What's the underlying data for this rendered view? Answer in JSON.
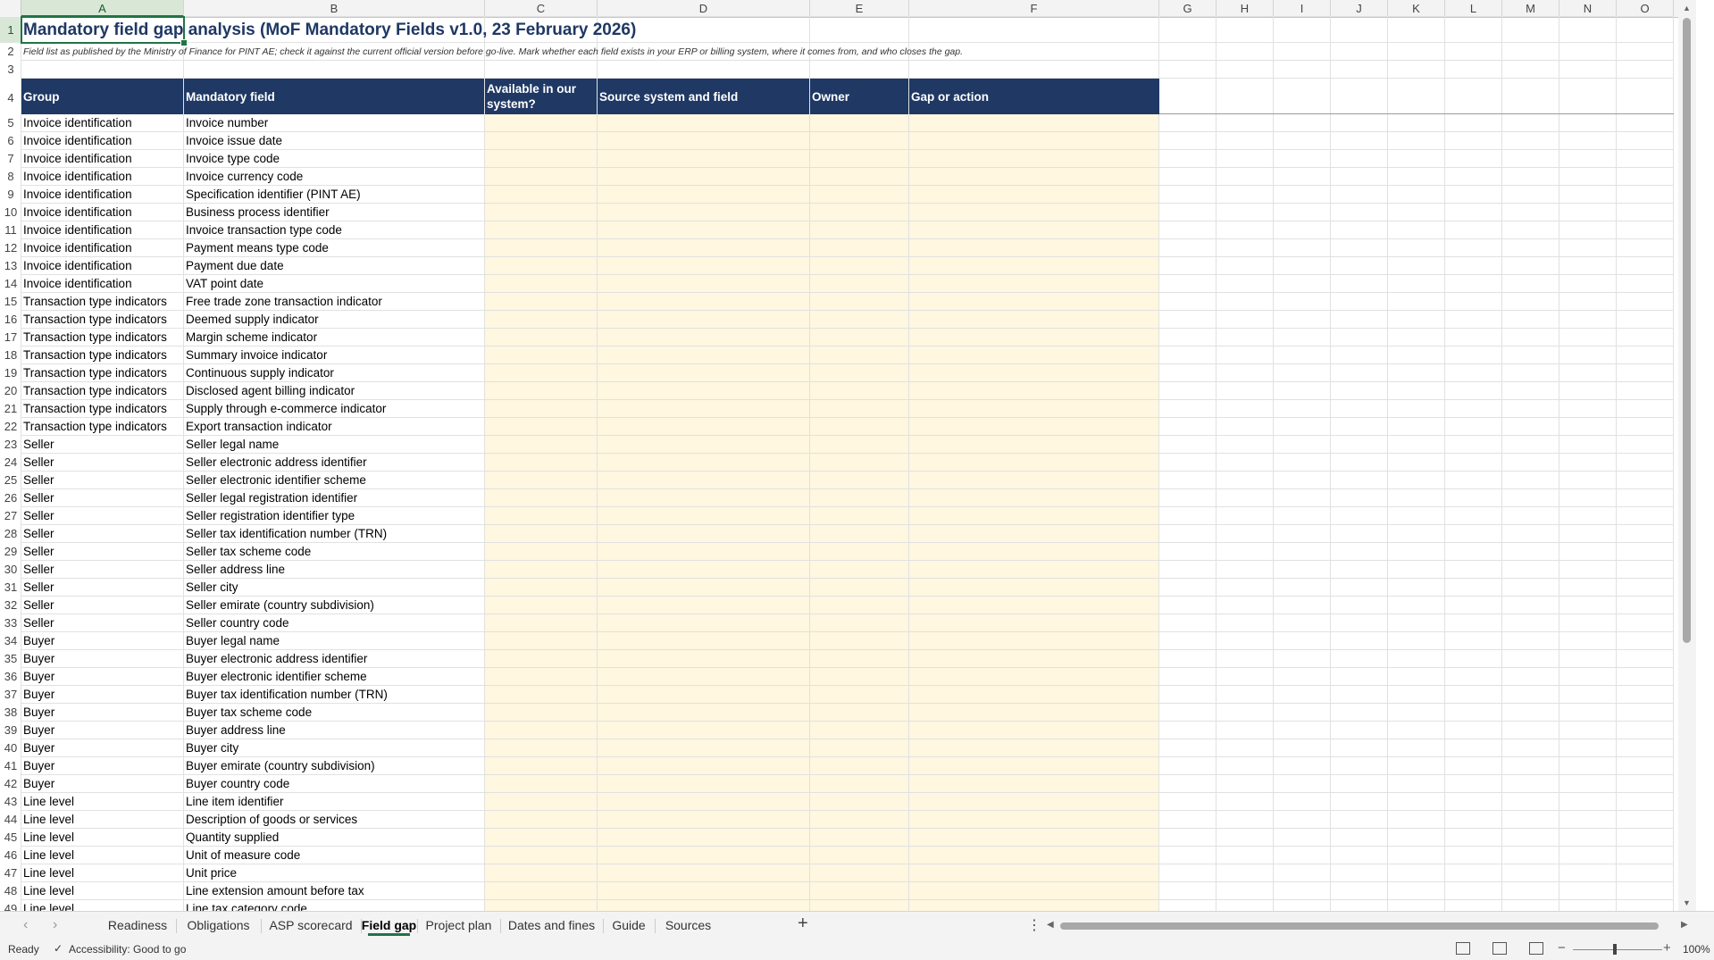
{
  "sheet": {
    "columns": [
      "A",
      "B",
      "C",
      "D",
      "E",
      "F",
      "G",
      "H",
      "I",
      "J",
      "K",
      "L",
      "M",
      "N",
      "O"
    ],
    "selected_cell": "A1",
    "title": "Mandatory field gap analysis (MoF Mandatory Fields v1.0, 23 February 2026)",
    "subtitle": "Field list as published by the Ministry of Finance for PINT AE; check it against the current official version before go-live. Mark whether each field exists in your ERP or billing system, where it comes from, and who closes the gap.",
    "headers": [
      "Group",
      "Mandatory field",
      "Available in our system?",
      "Source system and field",
      "Owner",
      "Gap or action"
    ],
    "rows": [
      [
        "Invoice identification",
        "Invoice number"
      ],
      [
        "Invoice identification",
        "Invoice issue date"
      ],
      [
        "Invoice identification",
        "Invoice type code"
      ],
      [
        "Invoice identification",
        "Invoice currency code"
      ],
      [
        "Invoice identification",
        "Specification identifier (PINT AE)"
      ],
      [
        "Invoice identification",
        "Business process identifier"
      ],
      [
        "Invoice identification",
        "Invoice transaction type code"
      ],
      [
        "Invoice identification",
        "Payment means type code"
      ],
      [
        "Invoice identification",
        "Payment due date"
      ],
      [
        "Invoice identification",
        "VAT point date"
      ],
      [
        "Transaction type indicators",
        "Free trade zone transaction indicator"
      ],
      [
        "Transaction type indicators",
        "Deemed supply indicator"
      ],
      [
        "Transaction type indicators",
        "Margin scheme indicator"
      ],
      [
        "Transaction type indicators",
        "Summary invoice indicator"
      ],
      [
        "Transaction type indicators",
        "Continuous supply indicator"
      ],
      [
        "Transaction type indicators",
        "Disclosed agent billing indicator"
      ],
      [
        "Transaction type indicators",
        "Supply through e-commerce indicator"
      ],
      [
        "Transaction type indicators",
        "Export transaction indicator"
      ],
      [
        "Seller",
        "Seller legal name"
      ],
      [
        "Seller",
        "Seller electronic address identifier"
      ],
      [
        "Seller",
        "Seller electronic identifier scheme"
      ],
      [
        "Seller",
        "Seller legal registration identifier"
      ],
      [
        "Seller",
        "Seller registration identifier type"
      ],
      [
        "Seller",
        "Seller tax identification number (TRN)"
      ],
      [
        "Seller",
        "Seller tax scheme code"
      ],
      [
        "Seller",
        "Seller address line"
      ],
      [
        "Seller",
        "Seller city"
      ],
      [
        "Seller",
        "Seller emirate (country subdivision)"
      ],
      [
        "Seller",
        "Seller country code"
      ],
      [
        "Buyer",
        "Buyer legal name"
      ],
      [
        "Buyer",
        "Buyer electronic address identifier"
      ],
      [
        "Buyer",
        "Buyer electronic identifier scheme"
      ],
      [
        "Buyer",
        "Buyer tax identification number (TRN)"
      ],
      [
        "Buyer",
        "Buyer tax scheme code"
      ],
      [
        "Buyer",
        "Buyer address line"
      ],
      [
        "Buyer",
        "Buyer city"
      ],
      [
        "Buyer",
        "Buyer emirate (country subdivision)"
      ],
      [
        "Buyer",
        "Buyer country code"
      ],
      [
        "Line level",
        "Line item identifier"
      ],
      [
        "Line level",
        "Description of goods or services"
      ],
      [
        "Line level",
        "Quantity supplied"
      ],
      [
        "Line level",
        "Unit of measure code"
      ],
      [
        "Line level",
        "Unit price"
      ],
      [
        "Line level",
        "Line extension amount before tax"
      ],
      [
        "Line level",
        "Line tax category code"
      ]
    ]
  },
  "tabs": {
    "items": [
      "Readiness",
      "Obligations",
      "ASP scorecard",
      "Field gap",
      "Project plan",
      "Dates and fines",
      "Guide",
      "Sources"
    ],
    "active": "Field gap",
    "add_label": "+",
    "more_label": "⋮"
  },
  "status": {
    "ready": "Ready",
    "accessibility": "Accessibility: Good to go",
    "zoom": "100%"
  },
  "colors": {
    "header_fill": "#1f3864",
    "input_fill": "#fff7e0",
    "accent": "#217346"
  }
}
